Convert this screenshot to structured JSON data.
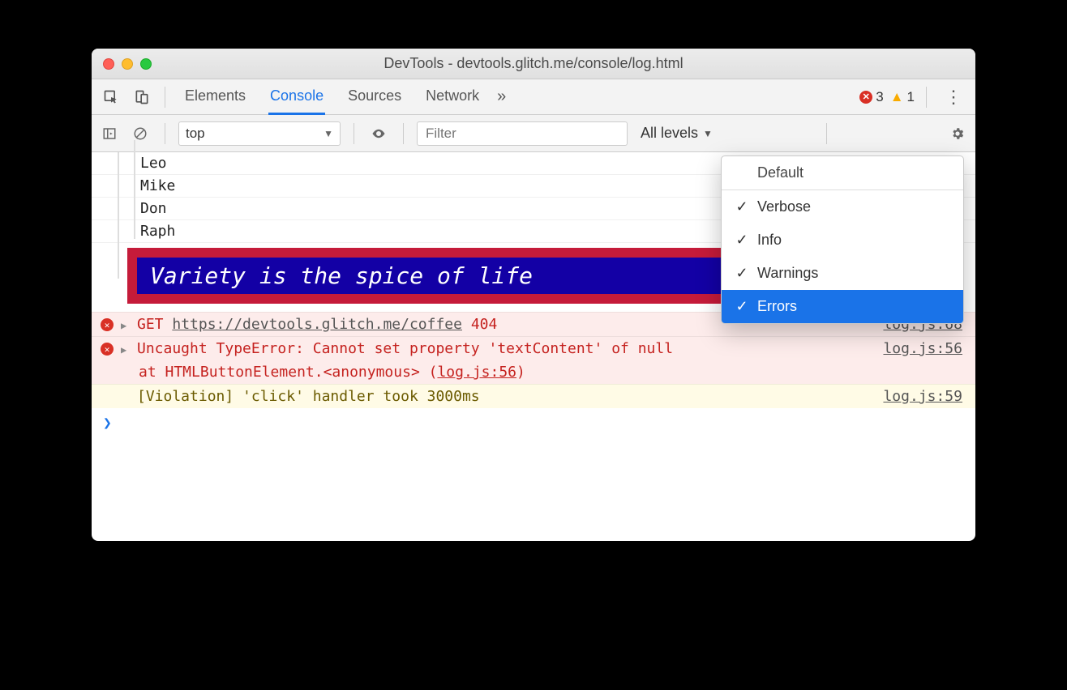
{
  "window": {
    "title": "DevTools - devtools.glitch.me/console/log.html"
  },
  "tabs": {
    "items": [
      "Elements",
      "Console",
      "Sources",
      "Network"
    ],
    "active_index": 1,
    "more_glyph": "»"
  },
  "counters": {
    "errors": "3",
    "warnings": "1"
  },
  "filterbar": {
    "context": "top",
    "filter_placeholder": "Filter",
    "levels_label": "All levels"
  },
  "tree_items": [
    "Leo",
    "Mike",
    "Don",
    "Raph"
  ],
  "styled_log": "Variety is the spice of life",
  "errors": {
    "e1": {
      "method": "GET",
      "url": "https://devtools.glitch.me/coffee",
      "status": "404",
      "source": "log.js:68"
    },
    "e2": {
      "title": "Uncaught TypeError: Cannot set property 'textContent' of null",
      "stack_prefix": "at HTMLButtonElement.<anonymous> (",
      "stack_link": "log.js:56",
      "stack_suffix": ")",
      "source": "log.js:56"
    }
  },
  "violation": {
    "text": "[Violation] 'click' handler took 3000ms",
    "source": "log.js:59"
  },
  "levels_menu": {
    "default": "Default",
    "options": [
      {
        "label": "Verbose",
        "checked": true,
        "selected": false
      },
      {
        "label": "Info",
        "checked": true,
        "selected": false
      },
      {
        "label": "Warnings",
        "checked": true,
        "selected": false
      },
      {
        "label": "Errors",
        "checked": true,
        "selected": true
      }
    ]
  }
}
